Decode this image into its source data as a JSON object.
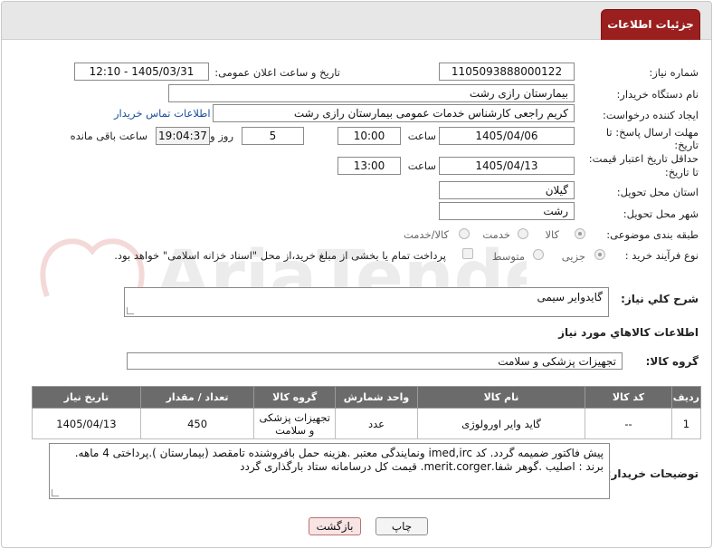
{
  "header": {
    "title": "جزئیات اطلاعات نیاز"
  },
  "watermark": "AriaTender.net",
  "form": {
    "need_number": {
      "label": "شماره نیاز:",
      "value": "1105093888000122"
    },
    "announce_datetime": {
      "label": "تاریخ و ساعت اعلان عمومی:",
      "value": "1405/03/31 - 12:10"
    },
    "buyer_org": {
      "label": "نام دستگاه خریدار:",
      "value": "بیمارستان رازی رشت"
    },
    "requester": {
      "label": "ایجاد کننده درخواست:",
      "value": "کریم راجعی کارشناس خدمات عمومی بیمارستان رازی رشت",
      "contact_link": "اطلاعات تماس خریدار"
    },
    "response_deadline": {
      "label_line1": "مهلت ارسال پاسخ: تا",
      "label_line2": "تاریخ:",
      "date": "1405/04/06",
      "time_label": "ساعت",
      "time": "10:00",
      "days": "5",
      "days_label": "روز و",
      "remaining": "19:04:37",
      "remaining_label": "ساعت باقی مانده"
    },
    "price_validity": {
      "label_line1": "حداقل تاریخ اعتبار قیمت:",
      "label_line2": "تا تاریخ:",
      "date": "1405/04/13",
      "time_label": "ساعت",
      "time": "13:00"
    },
    "province": {
      "label": "استان محل تحویل:",
      "value": "گیلان"
    },
    "city": {
      "label": "شهر محل تحویل:",
      "value": "رشت"
    },
    "category": {
      "label": "طبقه بندی موضوعی:",
      "options": [
        "کالا",
        "خدمت",
        "کالا/خدمت"
      ],
      "selected": "کالا"
    },
    "purchase_type": {
      "label": "نوع فرآیند خرید :",
      "options": [
        "جزیی",
        "متوسط"
      ],
      "selected": "جزیی",
      "payment_note": "پرداخت تمام یا بخشی از مبلغ خرید،از محل \"اسناد خزانه اسلامی\" خواهد بود."
    }
  },
  "need_description": {
    "label": "شرح كلي نياز:",
    "value": "گایدوایر سیمی"
  },
  "goods_info": {
    "title": "اطلاعات كالاهاي مورد نياز"
  },
  "goods_group": {
    "label": "گروه كالا:",
    "value": "تجهیزات پزشکی و سلامت"
  },
  "items_table": {
    "columns": [
      "رديف",
      "كد كالا",
      "نام كالا",
      "واحد شمارش",
      "گروه كالا",
      "تعداد / مقدار",
      "تاريخ نياز"
    ],
    "rows": [
      {
        "row": "1",
        "code": "--",
        "name": "گاید وایر اورولوژی",
        "unit": "عدد",
        "group": "تجهیزات پزشکی و سلامت",
        "qty": "450",
        "date": "1405/04/13"
      }
    ]
  },
  "buyer_notes": {
    "label": "توضیحات خریدار:",
    "value": "پیش فاکتور ضمیمه گردد. کد imed,irc ونمایندگی معتبر .هزینه حمل بافروشنده تامقصد (بیمارستان ).پرداختی 4 ماهه. برند : اصلیب .گوهر شفا.merit.corger. قیمت کل درسامانه ستاد بارگذاری گردد"
  },
  "buttons": {
    "print": "چاپ",
    "back": "بازگشت"
  }
}
